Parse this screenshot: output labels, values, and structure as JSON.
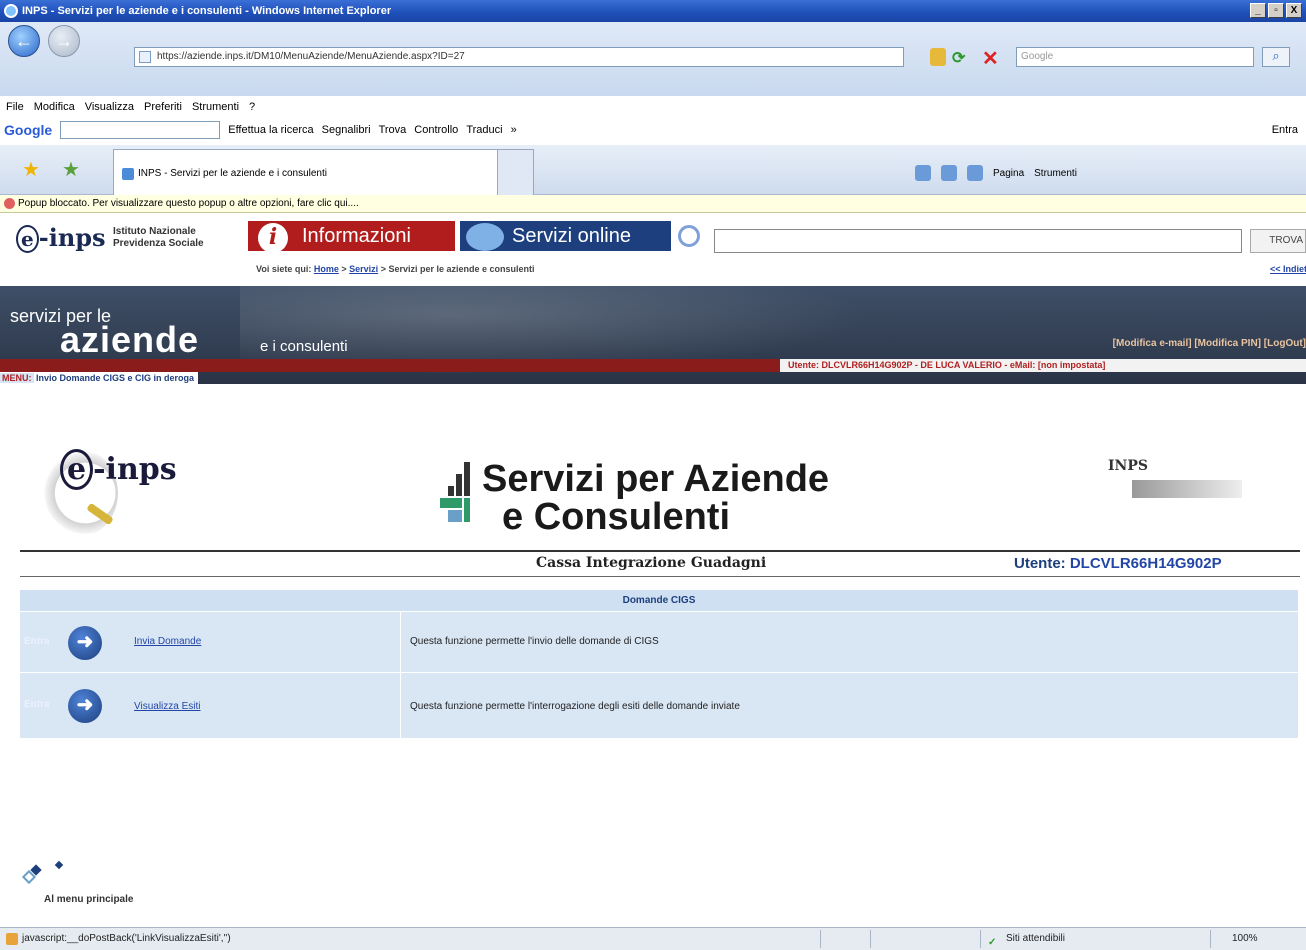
{
  "window": {
    "title": "INPS - Servizi per le aziende e i consulenti - Windows Internet Explorer",
    "controls": [
      "_",
      "▫",
      "X"
    ]
  },
  "browser": {
    "url": "https://aziende.inps.it/DM10/MenuAziende/MenuAziende.aspx?ID=27",
    "search_placeholder": "Google",
    "menu": [
      "File",
      "Modifica",
      "Visualizza",
      "Preferiti",
      "Strumenti",
      "?"
    ],
    "google_toolbar": {
      "logo": "Google",
      "search_button": "Effettua la ricerca",
      "bookmarks": "Segnalibri",
      "find": "Trova",
      "check": "Controllo",
      "translate": "Traduci",
      "more": "»",
      "signin": "Entra"
    },
    "tab_title": "INPS - Servizi per le aziende e i consulenti",
    "commands": {
      "page": "Pagina",
      "tools": "Strumenti"
    },
    "popup_message": "Popup bloccato. Per visualizzare questo popup o altre opzioni, fare clic qui...."
  },
  "inps_header": {
    "logo": "inps",
    "institute_line1": "Istituto Nazionale",
    "institute_line2": "Previdenza Sociale",
    "btn_info": "Informazioni",
    "btn_services": "Servizi online",
    "search_button": "TROVA",
    "breadcrumb_prefix": "Voi siete qui:",
    "breadcrumb_home": "Home",
    "breadcrumb_servizi": "Servizi",
    "breadcrumb_current": "> Servizi per le aziende e consulenti",
    "back_link": "<< Indietro"
  },
  "banner": {
    "line1": "servizi per le",
    "line2": "aziende",
    "line3": "e i consulenti",
    "links": "[Modifica e-mail] [Modifica PIN] [LogOut]",
    "user_info": "Utente: DLCVLR66H14G902P - DE LUCA VALERIO - eMail: [non impostata]",
    "menu_label": "MENU:",
    "menu_link": "Invio Domande CIGS e CIG in deroga"
  },
  "content": {
    "logo_text": "inps",
    "title_line1": "Servizi per Aziende",
    "title_line2": "e Consulenti",
    "seal_text": "INPS",
    "section_title": "Cassa Integrazione Guadagni",
    "user_label": "Utente:",
    "user_code": "DLCVLR66H14G902P"
  },
  "table": {
    "header": "Domande CIGS",
    "rows": [
      {
        "entra": "Entra",
        "link": "Invia Domande",
        "description": "Questa funzione permette l'invio delle domande di CIGS"
      },
      {
        "entra": "Entra",
        "link": "Visualizza Esiti",
        "description": "Questa funzione permette l'interrogazione degli esiti delle domande inviate"
      }
    ]
  },
  "footer": {
    "back_label": "Al menu principale"
  },
  "statusbar": {
    "text": "javascript:__doPostBack('LinkVisualizzaEsiti','')",
    "zone": "Siti attendibili",
    "zoom": "100%"
  },
  "colors": {
    "inps_red": "#b11d1d",
    "inps_blue": "#1d3f7d",
    "table_bg": "#d9e6f4",
    "link": "#2346a6"
  }
}
